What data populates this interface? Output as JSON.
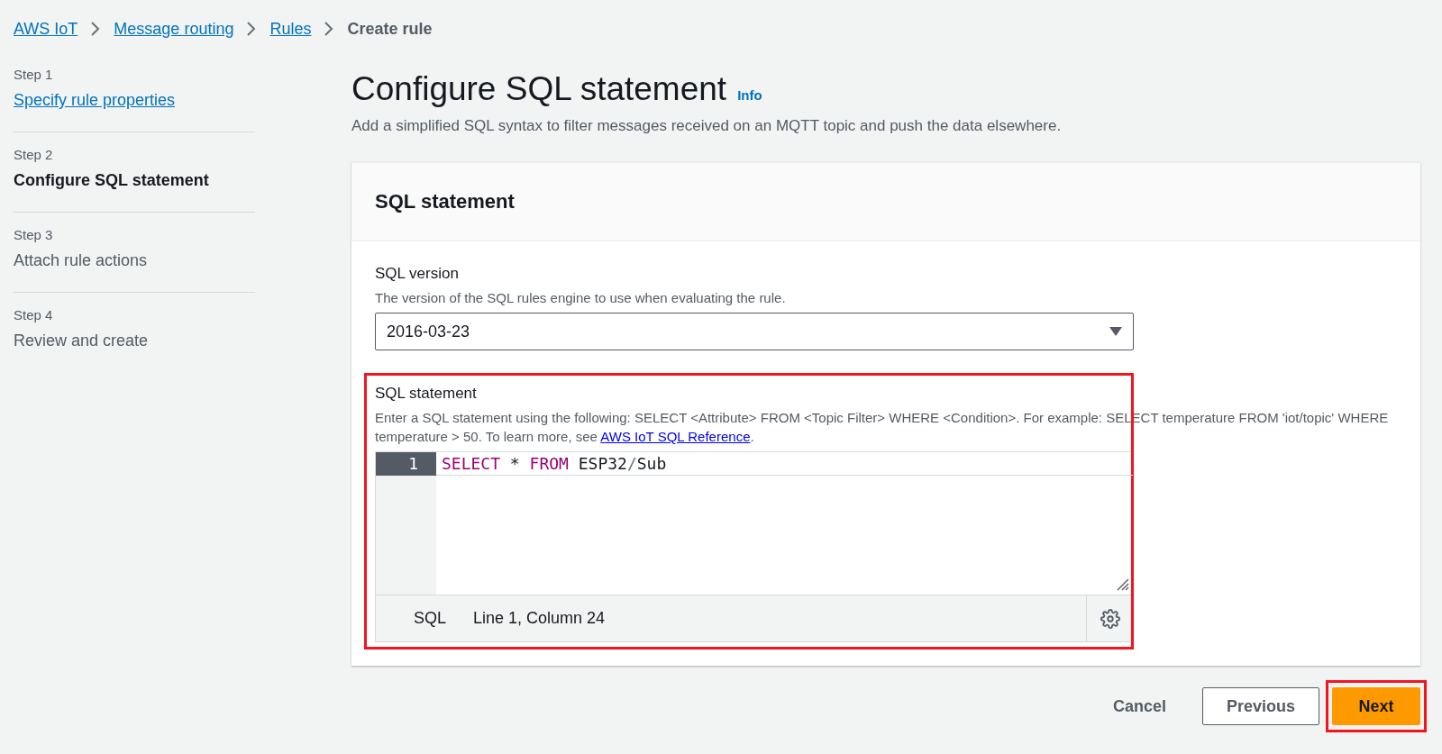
{
  "breadcrumbs": [
    {
      "label": "AWS IoT",
      "kind": "link"
    },
    {
      "label": "Message routing",
      "kind": "link"
    },
    {
      "label": "Rules",
      "kind": "link"
    },
    {
      "label": "Create rule",
      "kind": "current"
    }
  ],
  "steps": [
    {
      "step": "Step 1",
      "label": "Specify rule properties",
      "kind": "link",
      "selected": false
    },
    {
      "step": "Step 2",
      "label": "Configure SQL statement",
      "kind": "plain",
      "selected": true
    },
    {
      "step": "Step 3",
      "label": "Attach rule actions",
      "kind": "plain",
      "selected": false
    },
    {
      "step": "Step 4",
      "label": "Review and create",
      "kind": "plain",
      "selected": false
    }
  ],
  "page": {
    "title": "Configure SQL statement",
    "info": "Info",
    "description": "Add a simplified SQL syntax to filter messages received on an MQTT topic and push the data elsewhere."
  },
  "card": {
    "title": "SQL statement",
    "version": {
      "label": "SQL version",
      "hint": "The version of the SQL rules engine to use when evaluating the rule.",
      "value": "2016-03-23"
    },
    "statement": {
      "label": "SQL statement",
      "hint": "Enter a SQL statement using the following: SELECT <Attribute> FROM <Topic Filter> WHERE <Condition>. For example: SELECT temperature FROM 'iot/topic' WHERE temperature > 50. To learn more, see ",
      "link": "AWS IoT SQL Reference",
      "hint_end": ".",
      "highlighted": true,
      "line_number": "1",
      "tokens": [
        {
          "text": "SELECT",
          "kind": "keyword"
        },
        {
          "text": " * ",
          "kind": "plain"
        },
        {
          "text": "FROM",
          "kind": "keyword"
        },
        {
          "text": " ESP32",
          "kind": "plain"
        },
        {
          "text": "/",
          "kind": "operator"
        },
        {
          "text": "Sub",
          "kind": "plain"
        }
      ],
      "language": "SQL",
      "position": "Line 1, Column 24"
    }
  },
  "buttons": [
    {
      "label": "Cancel",
      "kind": "link",
      "highlighted": false
    },
    {
      "label": "Previous",
      "kind": "normal",
      "highlighted": false
    },
    {
      "label": "Next",
      "kind": "primary",
      "highlighted": true
    }
  ]
}
